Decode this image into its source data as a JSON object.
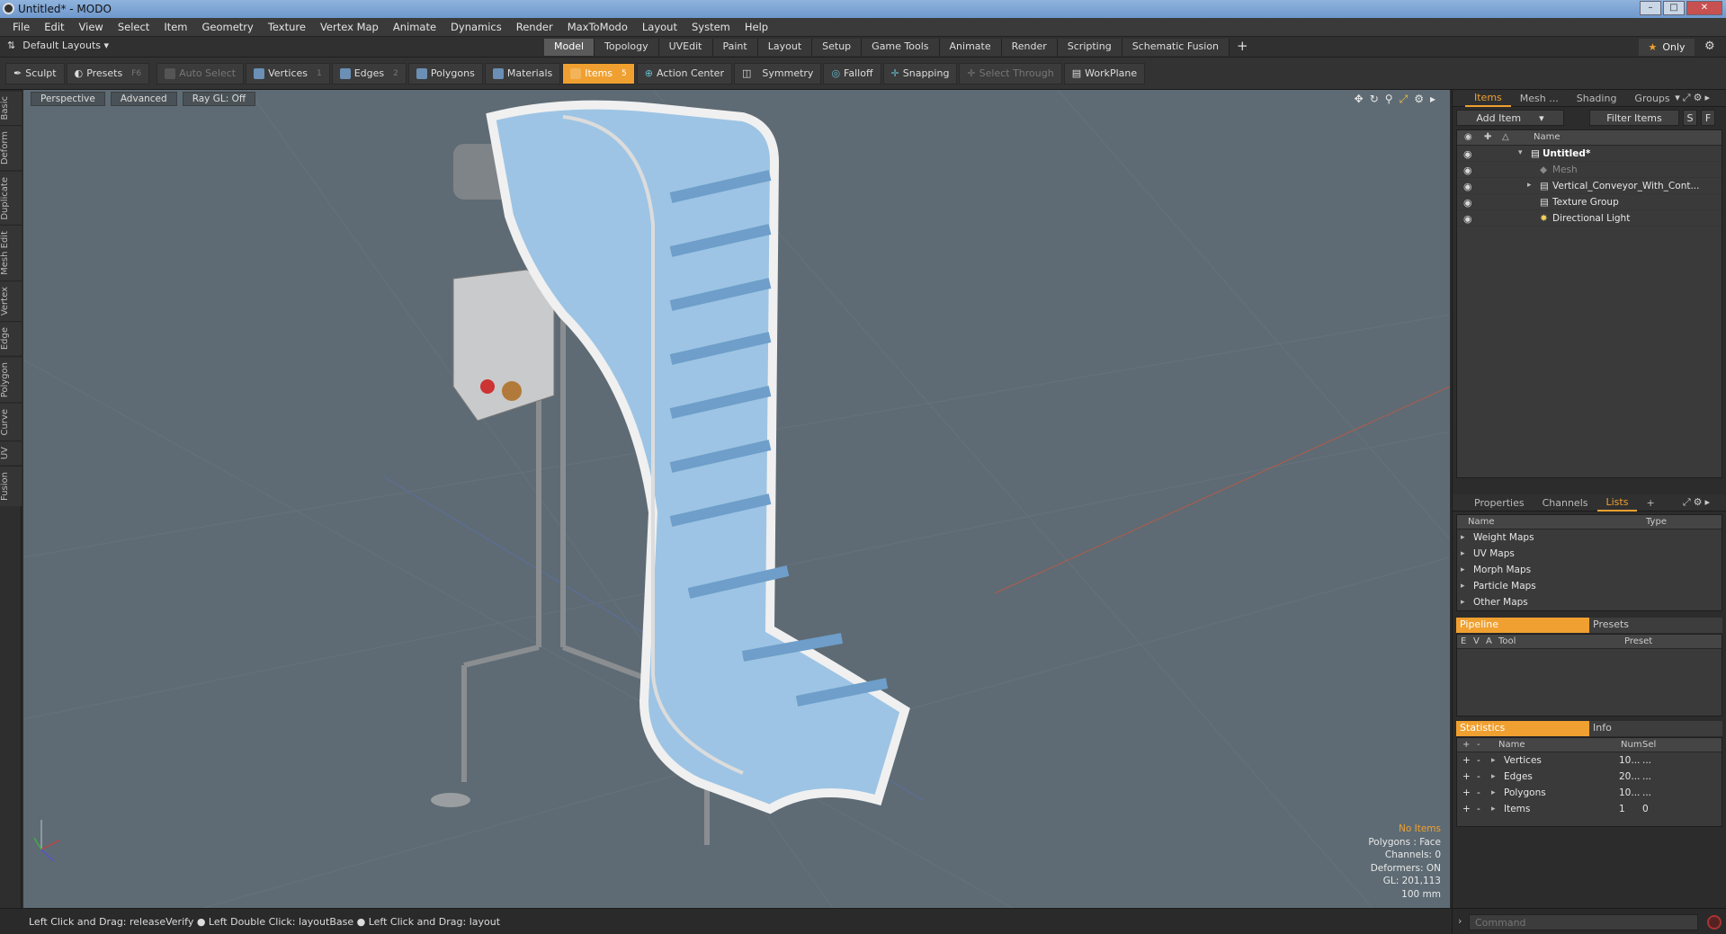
{
  "window": {
    "title": "Untitled* - MODO"
  },
  "menu": [
    "File",
    "Edit",
    "View",
    "Select",
    "Item",
    "Geometry",
    "Texture",
    "Vertex Map",
    "Animate",
    "Dynamics",
    "Render",
    "MaxToModo",
    "Layout",
    "System",
    "Help"
  ],
  "layout_selector": "Default Layouts ▾",
  "layout_tabs": [
    {
      "label": "Model",
      "active": true
    },
    {
      "label": "Topology"
    },
    {
      "label": "UVEdit"
    },
    {
      "label": "Paint"
    },
    {
      "label": "Layout"
    },
    {
      "label": "Setup"
    },
    {
      "label": "Game Tools"
    },
    {
      "label": "Animate"
    },
    {
      "label": "Render"
    },
    {
      "label": "Scripting"
    },
    {
      "label": "Schematic Fusion"
    }
  ],
  "only_label": "Only",
  "toolbar": {
    "sculpt": "Sculpt",
    "presets": "Presets",
    "presets_key": "F6",
    "auto_select": "Auto Select",
    "vertices": "Vertices",
    "vertices_num": "1",
    "edges": "Edges",
    "edges_num": "2",
    "polygons": "Polygons",
    "materials": "Materials",
    "items": "Items",
    "items_num": "5",
    "action_center": "Action Center",
    "symmetry": "Symmetry",
    "falloff": "Falloff",
    "snapping": "Snapping",
    "select_through": "Select Through",
    "workplane": "WorkPlane"
  },
  "left_strip": [
    "Basic",
    "Deform",
    "Duplicate",
    "Mesh Edit",
    "Vertex",
    "Edge",
    "Polygon",
    "Curve",
    "UV",
    "Fusion"
  ],
  "viewport": {
    "view": "Perspective",
    "mode": "Advanced",
    "raygl": "Ray GL: Off",
    "stats": {
      "no_items": "No Items",
      "polygons": "Polygons : Face",
      "channels": "Channels: 0",
      "deformers": "Deformers: ON",
      "gl": "GL: 201,113",
      "scale": "100 mm"
    }
  },
  "status": "Left Click and Drag: releaseVerify ● Left Double Click: layoutBase ● Left Click and Drag: layout",
  "items_panel": {
    "tabs": [
      "Items",
      "Mesh ...",
      "Shading",
      "Groups"
    ],
    "add_item": "Add Item",
    "filter_items": "Filter Items",
    "s_btn": "S",
    "f_btn": "F",
    "name_header": "Name",
    "tree": [
      {
        "label": "Untitled*",
        "level": 0,
        "bold": true
      },
      {
        "label": "Mesh",
        "level": 1,
        "dim": true
      },
      {
        "label": "Vertical_Conveyor_With_Cont...",
        "level": 1
      },
      {
        "label": "Texture Group",
        "level": 1
      },
      {
        "label": "Directional Light",
        "level": 1
      }
    ]
  },
  "lists_panel": {
    "tabs": [
      "Properties",
      "Channels",
      "Lists"
    ],
    "name_header": "Name",
    "type_header": "Type",
    "rows": [
      "Weight Maps",
      "UV Maps",
      "Morph Maps",
      "Particle Maps",
      "Other Maps"
    ]
  },
  "pipeline_panel": {
    "tabs": [
      "Pipeline",
      "Presets"
    ],
    "headers": {
      "e": "E",
      "v": "V",
      "a": "A",
      "tool": "Tool",
      "preset": "Preset"
    }
  },
  "stats_panel": {
    "tabs": [
      "Statistics",
      "Info"
    ],
    "headers": {
      "name": "Name",
      "num": "Num",
      "sel": "Sel"
    },
    "rows": [
      {
        "name": "Vertices",
        "num": "10...",
        "sel": "..."
      },
      {
        "name": "Edges",
        "num": "20...",
        "sel": "..."
      },
      {
        "name": "Polygons",
        "num": "10...",
        "sel": "..."
      },
      {
        "name": "Items",
        "num": "1",
        "sel": "0"
      }
    ]
  },
  "command": {
    "placeholder": "Command"
  }
}
